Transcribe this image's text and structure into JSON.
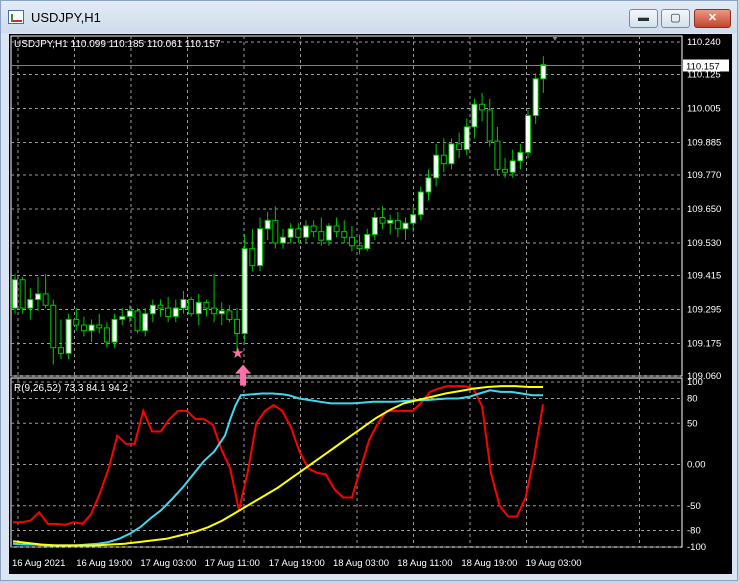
{
  "window": {
    "title": "USDJPY,H1",
    "buttons": {
      "minimize": "▬",
      "maximize": "▢",
      "close": "✕"
    }
  },
  "chart_info": {
    "symbol_line": "USDJPY,H1  110.099 110.185 110.061 110.157",
    "indicator_line": "R(9,26,52) 73.3 84.1 94.2",
    "current_price": "110.157",
    "colors": {
      "background": "#000000",
      "grid": "#9a9a9a",
      "bull_candle": "#ffffff",
      "bear_candle": "#000000",
      "wick": "#00c800",
      "r1": "#ff0000",
      "r2": "#40d8f0",
      "r3": "#ffff00",
      "signal_arrow": "#ff6fa8"
    }
  },
  "chart_data": [
    {
      "type": "candlestick",
      "title": "USDJPY,H1",
      "y_ticks": [
        "110.240",
        "110.125",
        "110.005",
        "109.885",
        "109.770",
        "109.650",
        "109.530",
        "109.415",
        "109.295",
        "109.175",
        "109.060"
      ],
      "ylim": [
        109.06,
        110.24
      ],
      "x_ticks": [
        "16 Aug 2021",
        "16 Aug 19:00",
        "17 Aug 03:00",
        "17 Aug 11:00",
        "17 Aug 19:00",
        "18 Aug 03:00",
        "18 Aug 11:00",
        "18 Aug 19:00",
        "19 Aug 03:00"
      ],
      "ohlc": [
        [
          109.3,
          109.42,
          109.28,
          109.4
        ],
        [
          109.4,
          109.41,
          109.28,
          109.3
        ],
        [
          109.3,
          109.37,
          109.26,
          109.33
        ],
        [
          109.33,
          109.41,
          109.29,
          109.35
        ],
        [
          109.35,
          109.42,
          109.3,
          109.31
        ],
        [
          109.31,
          109.33,
          109.1,
          109.16
        ],
        [
          109.16,
          109.26,
          109.12,
          109.14
        ],
        [
          109.14,
          109.28,
          109.12,
          109.26
        ],
        [
          109.26,
          109.3,
          109.22,
          109.24
        ],
        [
          109.24,
          109.27,
          109.2,
          109.22
        ],
        [
          109.22,
          109.26,
          109.18,
          109.24
        ],
        [
          109.24,
          109.28,
          109.21,
          109.23
        ],
        [
          109.23,
          109.25,
          109.16,
          109.18
        ],
        [
          109.18,
          109.28,
          109.16,
          109.26
        ],
        [
          109.26,
          109.3,
          109.24,
          109.27
        ],
        [
          109.27,
          109.31,
          109.25,
          109.29
        ],
        [
          109.29,
          109.3,
          109.21,
          109.22
        ],
        [
          109.22,
          109.3,
          109.2,
          109.28
        ],
        [
          109.28,
          109.33,
          109.25,
          109.31
        ],
        [
          109.31,
          109.33,
          109.27,
          109.3
        ],
        [
          109.3,
          109.34,
          109.25,
          109.27
        ],
        [
          109.27,
          109.33,
          109.25,
          109.3
        ],
        [
          109.3,
          109.36,
          109.28,
          109.33
        ],
        [
          109.33,
          109.34,
          109.27,
          109.28
        ],
        [
          109.28,
          109.35,
          109.24,
          109.32
        ],
        [
          109.32,
          109.33,
          109.27,
          109.3
        ],
        [
          109.3,
          109.42,
          109.25,
          109.28
        ],
        [
          109.28,
          109.32,
          109.24,
          109.29
        ],
        [
          109.29,
          109.31,
          109.25,
          109.26
        ],
        [
          109.26,
          109.3,
          109.14,
          109.21
        ],
        [
          109.21,
          109.56,
          109.18,
          109.51
        ],
        [
          109.51,
          109.58,
          109.43,
          109.45
        ],
        [
          109.45,
          109.62,
          109.43,
          109.58
        ],
        [
          109.58,
          109.64,
          109.54,
          109.61
        ],
        [
          109.61,
          109.66,
          109.51,
          109.53
        ],
        [
          109.53,
          109.58,
          109.51,
          109.55
        ],
        [
          109.55,
          109.6,
          109.53,
          109.58
        ],
        [
          109.58,
          109.6,
          109.53,
          109.55
        ],
        [
          109.55,
          109.61,
          109.53,
          109.59
        ],
        [
          109.59,
          109.61,
          109.55,
          109.57
        ],
        [
          109.57,
          109.62,
          109.52,
          109.54
        ],
        [
          109.54,
          109.6,
          109.52,
          109.59
        ],
        [
          109.59,
          109.62,
          109.55,
          109.57
        ],
        [
          109.57,
          109.61,
          109.53,
          109.55
        ],
        [
          109.55,
          109.59,
          109.5,
          109.52
        ],
        [
          109.52,
          109.56,
          109.49,
          109.51
        ],
        [
          109.51,
          109.58,
          109.5,
          109.56
        ],
        [
          109.56,
          109.64,
          109.54,
          109.62
        ],
        [
          109.62,
          109.66,
          109.58,
          109.6
        ],
        [
          109.6,
          109.63,
          109.56,
          109.61
        ],
        [
          109.61,
          109.64,
          109.55,
          109.58
        ],
        [
          109.58,
          109.62,
          109.54,
          109.6
        ],
        [
          109.6,
          109.66,
          109.57,
          109.63
        ],
        [
          109.63,
          109.73,
          109.61,
          109.71
        ],
        [
          109.71,
          109.79,
          109.68,
          109.76
        ],
        [
          109.76,
          109.88,
          109.73,
          109.84
        ],
        [
          109.84,
          109.9,
          109.78,
          109.81
        ],
        [
          109.81,
          109.9,
          109.79,
          109.88
        ],
        [
          109.88,
          109.92,
          109.83,
          109.86
        ],
        [
          109.86,
          109.97,
          109.84,
          109.94
        ],
        [
          109.94,
          110.04,
          109.9,
          110.02
        ],
        [
          110.02,
          110.06,
          109.96,
          110.0
        ],
        [
          110.0,
          110.04,
          109.87,
          109.89
        ],
        [
          109.89,
          109.94,
          109.77,
          109.79
        ],
        [
          109.79,
          109.83,
          109.76,
          109.78
        ],
        [
          109.78,
          109.86,
          109.76,
          109.82
        ],
        [
          109.82,
          109.88,
          109.79,
          109.85
        ],
        [
          109.85,
          110.0,
          109.83,
          109.98
        ],
        [
          109.98,
          110.13,
          109.95,
          110.11
        ],
        [
          110.11,
          110.19,
          110.06,
          110.16
        ]
      ]
    },
    {
      "type": "line",
      "title": "R(9,26,52) 73.3 84.1 94.2",
      "y_ticks": [
        "100",
        "80",
        "50",
        "0.00",
        "-50",
        "-80",
        "-100"
      ],
      "ylim": [
        -100,
        100
      ],
      "series": [
        {
          "name": "R(9)",
          "color": "#ff0000",
          "values": [
            -70,
            -70,
            -68,
            -58,
            -72,
            -72,
            -73,
            -70,
            -72,
            -60,
            -35,
            -5,
            35,
            25,
            25,
            65,
            40,
            40,
            55,
            65,
            65,
            55,
            55,
            48,
            18,
            -5,
            -55,
            -10,
            50,
            65,
            72,
            65,
            45,
            15,
            -5,
            -10,
            -12,
            -30,
            -40,
            -40,
            -5,
            30,
            50,
            65,
            65,
            65,
            65,
            75,
            88,
            92,
            95,
            95,
            95,
            92,
            70,
            -10,
            -50,
            -63,
            -63,
            -40,
            10,
            73
          ],
          "x_positions": [
            0,
            1,
            2,
            3,
            4,
            5,
            6,
            7,
            8,
            9,
            10,
            11,
            12,
            13,
            14,
            15,
            16,
            17,
            18,
            19,
            20,
            21,
            22,
            23,
            24,
            25,
            26,
            27,
            28,
            29,
            30,
            31,
            32,
            33,
            34,
            35,
            36,
            37,
            38,
            39,
            40,
            41,
            42,
            43,
            44,
            45,
            46,
            47,
            48,
            49,
            50,
            51,
            52,
            53,
            54,
            55,
            56,
            57,
            58,
            59,
            60,
            61
          ]
        },
        {
          "name": "R(26)",
          "color": "#40d8f0",
          "values": [
            -96,
            -97,
            -97,
            -98,
            -98,
            -98,
            -98,
            -97,
            -96,
            -94,
            -90,
            -84,
            -76,
            -65,
            -55,
            -42,
            -28,
            -12,
            4,
            16,
            35,
            55,
            72,
            84,
            85,
            86,
            86,
            85,
            84,
            80,
            78,
            76,
            74,
            74,
            74,
            75,
            76,
            76,
            76,
            77,
            78,
            78,
            79,
            80,
            80,
            82,
            86,
            90,
            88,
            88,
            86,
            84,
            84
          ],
          "x_positions": [
            0,
            2,
            4,
            6,
            8,
            10,
            12,
            14,
            16,
            18,
            20,
            22,
            24,
            26,
            28,
            30,
            32,
            34,
            36,
            38,
            40,
            41,
            42,
            43,
            45,
            47,
            49,
            51,
            52,
            54,
            56,
            58,
            60,
            62,
            64,
            66,
            68,
            70,
            72,
            74,
            76,
            78,
            80,
            82,
            84,
            86,
            88,
            90,
            92,
            94,
            96,
            98,
            100
          ]
        },
        {
          "name": "R(52)",
          "color": "#ffff00",
          "values": [
            -93,
            -95,
            -97,
            -98,
            -98,
            -98,
            -98,
            -97,
            -96,
            -94,
            -92,
            -90,
            -86,
            -82,
            -76,
            -68,
            -58,
            -48,
            -38,
            -28,
            -16,
            -4,
            8,
            20,
            32,
            44,
            56,
            66,
            74,
            78,
            82,
            86,
            89,
            92,
            94,
            95,
            95,
            94,
            94
          ],
          "x_positions": [
            0,
            3,
            6,
            9,
            12,
            15,
            18,
            21,
            24,
            27,
            30,
            33,
            36,
            39,
            42,
            45,
            48,
            51,
            54,
            57,
            60,
            63,
            66,
            69,
            72,
            75,
            78,
            81,
            84,
            87,
            90,
            93,
            96,
            99,
            102,
            105,
            108,
            111,
            114
          ]
        }
      ]
    }
  ],
  "signal": {
    "star": "★",
    "arrow": "up-arrow-icon"
  }
}
